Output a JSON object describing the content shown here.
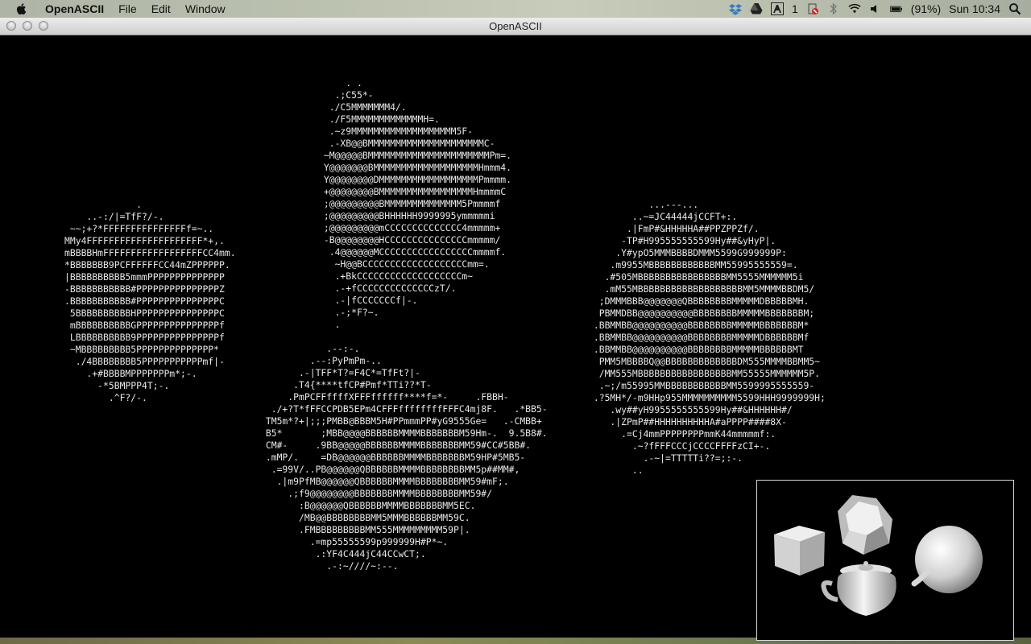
{
  "menubar": {
    "apple_icon": "apple-icon",
    "app_name": "OpenASCII",
    "menus": [
      "File",
      "Edit",
      "Window"
    ],
    "status": {
      "badge_count": "1",
      "battery_percent": "(91%)",
      "clock": "Sun 10:34"
    }
  },
  "window": {
    "title": "OpenASCII"
  },
  "ascii_art": {
    "top_blob": "     . .\n   .;C55*-\n  ./C5MMMMMMM4/.\n  ./F5MMMMMMMMMMMMMH=.\n  .~z9MMMMMMMMMMMMMMMMMMM5F-\n  .-XB@@BMMMMMMMMMMMMMMMMMMMMMC-\n ~M@@@@@BMMMMMMMMMMMMMMMMMMMMMMPm=.\n Y@@@@@@@BMMMMMMMMMMMMMMMMMMMHmmm4.\n Y@@@@@@@@DMMMMMMMMMMMMMMMMMMPmmmm.\n +@@@@@@@@BMMMMMMMMMMMMMMMMMHmmmmC\n ;@@@@@@@@@BMMMMMMMMMMMMMM5Pmmmmf\n ;@@@@@@@@@BHHHHHH9999995ymmmmmi\n ;@@@@@@@@@mCCCCCCCCCCCCCC4mmmmm+\n -B@@@@@@@@HCCCCCCCCCCCCCCCmmmmm/\n  .4@@@@@@MCCCCCCCCCCCCCCCCCmmmmf.\n   ~H@@BCCCCCCCCCCCCCCCCCCCmm=.\n   .+BkCCCCCCCCCCCCCCCCCCCm~\n   .-+fCCCCCCCCCCCCCCzT/.\n   .-|fCCCCCCCf|-.\n   .-;*F?~.\n   .",
    "left_blob": "             .\n    ..-:/|=TfF?/-.\n ~~;+?*FFFFFFFFFFFFFFFf=~..\nMMy4FFFFFFFFFFFFFFFFFFFFF*+,.\nmBBBBHmFFFFFFFFFFFFFFFFFFCC4mm.\n*BBBBBBB9PCFFFFFFCC44mZPPPPPP.\n|BBBBBBBBBB5mmmPPPPPPPPPPPPPP\n-BBBBBBBBBBB#PPPPPPPPPPPPPPPZ\n.BBBBBBBBBBB#PPPPPPPPPPPPPPPC\n 5BBBBBBBBBBHPPPPPPPPPPPPPPPC\n mBBBBBBBBBBGPPPPPPPPPPPPPPPf\n LBBBBBBBBBB9PPPPPPPPPPPPPPPf\n ~MBBBBBBBBB5PPPPPPPPPPPPPP*\n  ./4BBBBBBBB5PPPPPPPPPPPmf|-\n    .+#BBBBMPPPPPPPm*;-.\n      -*5BMPPP4T;-.\n        .^F?/-.",
    "right_blob": "           ...---...\n        ..~=JC44444jCCFT+:.\n       .|FmP#&HHHHHA##PPZPPZf/.\n      -TP#H995555555599Hy##&yHyP|.\n     .Y#ypO5MMMBBBBDMMM5599G999999P:\n    .m9955MBBBBBBBBBBBBMM55995555559=.\n   .#505MBBBBBBBBBBBBBBBBMM5555MMMMMM5i\n   .mM55MBBBBBBBBBBBBBBBBBBBMM5MMMMBBDM5/\n  ;DMMMBBB@@@@@@@QBBBBBBBBMMMMMDBBBBBMH.\n  PBMMDBB@@@@@@@@@@BBBBBBBBMMMMMBBBBBBBM;\n .BBMMBB@@@@@@@@@@BBBBBBBBMMMMMBBBBBBBM*\n .BBMMBB@@@@@@@@@@BBBBBBBBMMMMMDBBBBBBMf\n .BBMMBB@@@@@@@@@@BBBBBBBBMMMMMBBBBBBMT\n  PMM5MBBBBQ@@BBBBBBBBBBBBBDM555MMMMBBMM5~\n  /MM555MBBBBBBBBBBBBBBBBBMM55555MMMMMM5P.\n  .~;/m55995MMBBBBBBBBBBBMM5599995555559-\n .?5MH*/-m9HHp955MMMMMMMMMM5599HHH9999999H;\n    .wy##yH9955555555599Hy##&HHHHHH#/\n    .|ZPmP##HHHHHHHHHHA#aPPPP####8X-\n      .=Cj4mmPPPPPPPPmmK44mmmmmf:.\n        .~?fFFFCCCjCCCCFFFFzCI+-.\n          .-~|=TTTTTi??=;:-.\n        ..",
    "bottom_blob": "            .--:-.\n         .--:PyPmPm-..\n       .-|TFF*T?=F4C*=TfFt?|-\n      .T4{****tfCP#Pmf*TTi??*T-\n     .PmPCFFffffXFFFffffff****f=*-     .FBBH-\n  ./+?T*fFFCCPDB5EPm4CFFFffffffffFFFC4mj8F.   .*BB5-\n TM5m*?+|;;;PMBB@BBBM5H#PPmmmPP#yG9555Ge=   .-CMBB+\n B5*       ;MBB@@@@BBBBBBMMMMBBBBBBBM59Hm-.  9.5B8#.\n CM#-     .9BB@@@@@BBBBBBMMMMBBBBBBBMM59#CC#5BB#.\n .mMP/.    =DB@@@@@@BBBBBBMMMMBBBBBBBM59HP#5MB5-\n  .=99V/..PB@@@@@@QBBBBBBMMMMBBBBBBBBMM5p##MM#,\n   .|m9PfMB@@@@@@QBBBBBBMMMMBBBBBBBBMM59#mF;.\n     .;f9@@@@@@@@BBBBBBBMMMMBBBBBBBBMM59#/\n       :B@@@@@@QBBBBBBMMMMBBBBBBBMM5EC.\n       /MB@@BBBBBBBBMM5MMMBBBBBBMM59C.\n       .FMBBBBBBBBBMM555MMMMMMMMM59P|.\n         .=mp55555599p999999H#P*~.\n          .:YF4C444jC44CCwCT;.\n            .-:~////~:--."
  },
  "preview": {
    "objects": [
      "cube",
      "dodecahedron",
      "sphere",
      "teapot"
    ]
  }
}
